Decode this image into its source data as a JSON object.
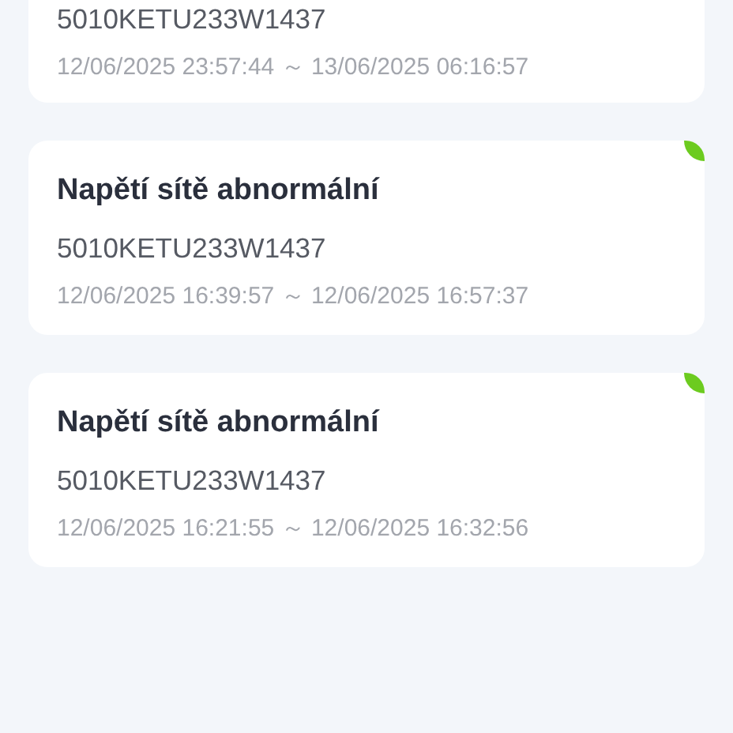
{
  "alarms": [
    {
      "serial": "5010KETU233W1437",
      "period": "12/06/2025 23:57:44 ～ 13/06/2025 06:16:57"
    },
    {
      "title": "Napětí sítě abnormální",
      "serial": "5010KETU233W1437",
      "period": "12/06/2025 16:39:57 ～ 12/06/2025 16:57:37",
      "color": "#6ccb1f"
    },
    {
      "title": "Napětí sítě abnormální",
      "serial": "5010KETU233W1437",
      "period": "12/06/2025 16:21:55 ～ 12/06/2025 16:32:56",
      "color": "#6ccb1f"
    }
  ]
}
